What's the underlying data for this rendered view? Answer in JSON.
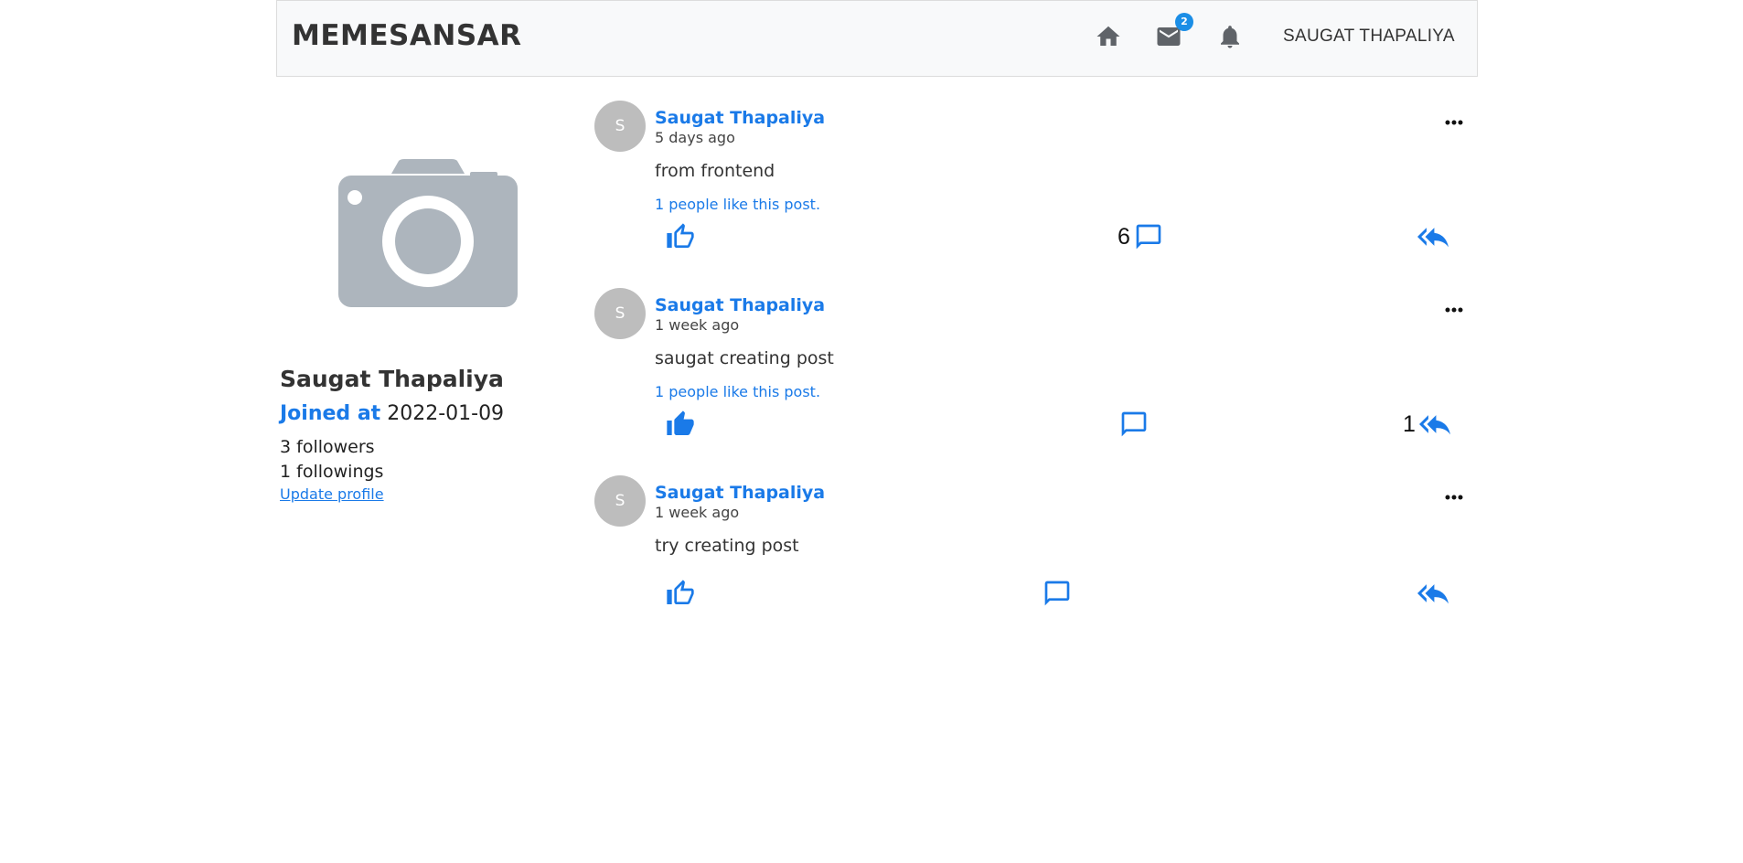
{
  "navbar": {
    "brand": "MEMESANSAR",
    "mail_badge": "2",
    "user_name": "SAUGAT THAPALIYA"
  },
  "profile": {
    "name": "Saugat Thapaliya",
    "joined_label": "Joined at",
    "joined_date": "2022-01-09",
    "followers": "3 followers",
    "followings": "1 followings",
    "update_link": "Update profile"
  },
  "posts": [
    {
      "avatar_letter": "S",
      "author": "Saugat Thapaliya",
      "time": "5 days ago",
      "content": "from frontend",
      "likes_text": "1 people like this post.",
      "liked": false,
      "comment_count": "6",
      "share_count": ""
    },
    {
      "avatar_letter": "S",
      "author": "Saugat Thapaliya",
      "time": "1 week ago",
      "content": "saugat creating post",
      "likes_text": "1 people like this post.",
      "liked": true,
      "comment_count": "",
      "share_count": "1"
    },
    {
      "avatar_letter": "S",
      "author": "Saugat Thapaliya",
      "time": "1 week ago",
      "content": "try creating post",
      "likes_text": "",
      "liked": false,
      "comment_count": "",
      "share_count": ""
    }
  ],
  "colors": {
    "accent": "#1a7ae8",
    "icon_gray": "#5f6368",
    "avatar_bg": "#bdbdbd",
    "badge": "#1b8ee6"
  }
}
